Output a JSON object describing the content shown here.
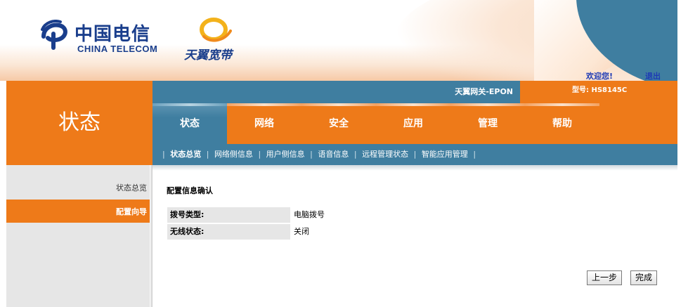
{
  "banner": {
    "brand_cn": "中国电信",
    "brand_en": "CHINA TELECOM",
    "subbrand": "天翼宽带",
    "welcome": "欢迎您!",
    "logout": "退出"
  },
  "header": {
    "section_title": "状态",
    "gateway_name": "天翼网关-EPON",
    "model_label": "型号: HS8145C"
  },
  "tabs": [
    {
      "label": "状态"
    },
    {
      "label": "网络"
    },
    {
      "label": "安全"
    },
    {
      "label": "应用"
    },
    {
      "label": "管理"
    },
    {
      "label": "帮助"
    }
  ],
  "subnav": [
    {
      "label": "状态总览"
    },
    {
      "label": "网络侧信息"
    },
    {
      "label": "用户侧信息"
    },
    {
      "label": "语音信息"
    },
    {
      "label": "远程管理状态"
    },
    {
      "label": "智能应用管理"
    }
  ],
  "sidebar": {
    "items": [
      {
        "label": "状态总览"
      },
      {
        "label": "配置向导"
      }
    ]
  },
  "main": {
    "title": "配置信息确认",
    "rows": [
      {
        "label": "拨号类型:",
        "value": "电脑拨号"
      },
      {
        "label": "无线状态:",
        "value": "关闭"
      }
    ],
    "prev_button": "上一步",
    "finish_button": "完成"
  },
  "colors": {
    "orange": "#ee7a19",
    "blue": "#3f7ea0",
    "brand_blue": "#1a3e8c",
    "sidebar_gray": "#e6e6e6"
  }
}
